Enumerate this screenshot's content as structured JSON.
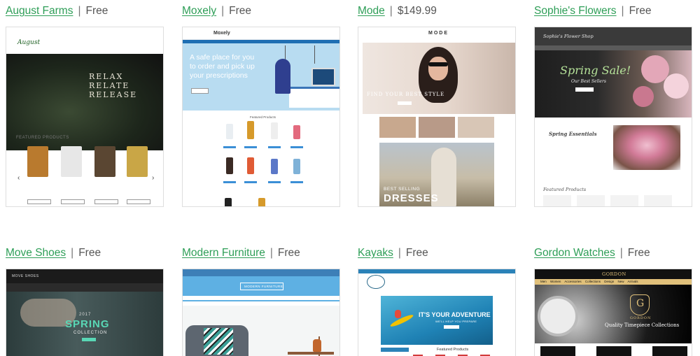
{
  "cards": [
    {
      "name": "August Farms",
      "price": "Free",
      "thumb": {
        "logo": "August",
        "hero_lines": [
          "RELAX",
          "RELATE",
          "RELEASE"
        ],
        "section": "FEATURED PRODUCTS",
        "arrow_left": "‹",
        "arrow_right": "›"
      }
    },
    {
      "name": "Moxely",
      "price": "Free",
      "thumb": {
        "logo": "Moxely",
        "hero_lines": [
          "A safe place for you",
          "to order and pick up",
          "your prescriptions"
        ],
        "section": "Featured Products"
      }
    },
    {
      "name": "Mode",
      "price": "$149.99",
      "thumb": {
        "logo": "MODE",
        "hero_text": "FIND YOUR BEST STYLE",
        "best": "BEST SELLING",
        "dresses": "DRESSES"
      }
    },
    {
      "name": "Sophie's Flowers",
      "price": "Free",
      "thumb": {
        "logo": "Sophie's Flower Shop",
        "spring": "Spring Sale!",
        "sub": "Our Best Sellers",
        "essentials": "Spring Essentials",
        "featured": "Featured Products"
      }
    },
    {
      "name": "Move Shoes",
      "price": "Free",
      "thumb": {
        "logo": "MOVE SHOES",
        "year": "2017",
        "spring": "SPRING",
        "collection": "COLLECTION"
      }
    },
    {
      "name": "Modern Furniture",
      "price": "Free",
      "thumb": {
        "badge": "MODERN FURNITURE"
      }
    },
    {
      "name": "Kayaks",
      "price": "Free",
      "thumb": {
        "adventure": "IT'S YOUR ADVENTURE",
        "sub": "WE'LL HELP YOU PREPARE",
        "featured": "Featured Products"
      }
    },
    {
      "name": "Gordon Watches",
      "price": "Free",
      "thumb": {
        "logo": "GORDON",
        "nav": "Men Women Accessories Collections Design New Arrivals",
        "crest_letter": "G",
        "crest_word": "GORDON",
        "tagline": "Quality Timepiece Collections"
      }
    }
  ],
  "separator": "|",
  "colors": {
    "link": "#2e9e57",
    "price": "#555555",
    "border": "#dedede"
  }
}
